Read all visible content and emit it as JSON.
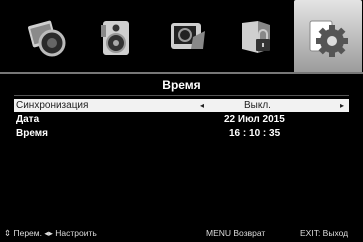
{
  "tabs": [
    {
      "icon": "photo-icon"
    },
    {
      "icon": "speaker-icon"
    },
    {
      "icon": "tv-channel-icon"
    },
    {
      "icon": "lock-icon"
    },
    {
      "icon": "gear-icon",
      "active": true
    }
  ],
  "title": "Время",
  "rows": {
    "sync": {
      "label": "Синхронизация",
      "value": "Выкл.",
      "left_arrow": "◂",
      "right_arrow": "▸"
    },
    "date": {
      "label": "Дата",
      "value": "22  Июл 2015"
    },
    "time": {
      "label": "Время",
      "value": "16 : 10 : 35"
    }
  },
  "footer": {
    "move": "⇕ Перем. ◂▸ Настроить",
    "menu": "MENU Возврат",
    "exit": "EXIT: Выход"
  }
}
